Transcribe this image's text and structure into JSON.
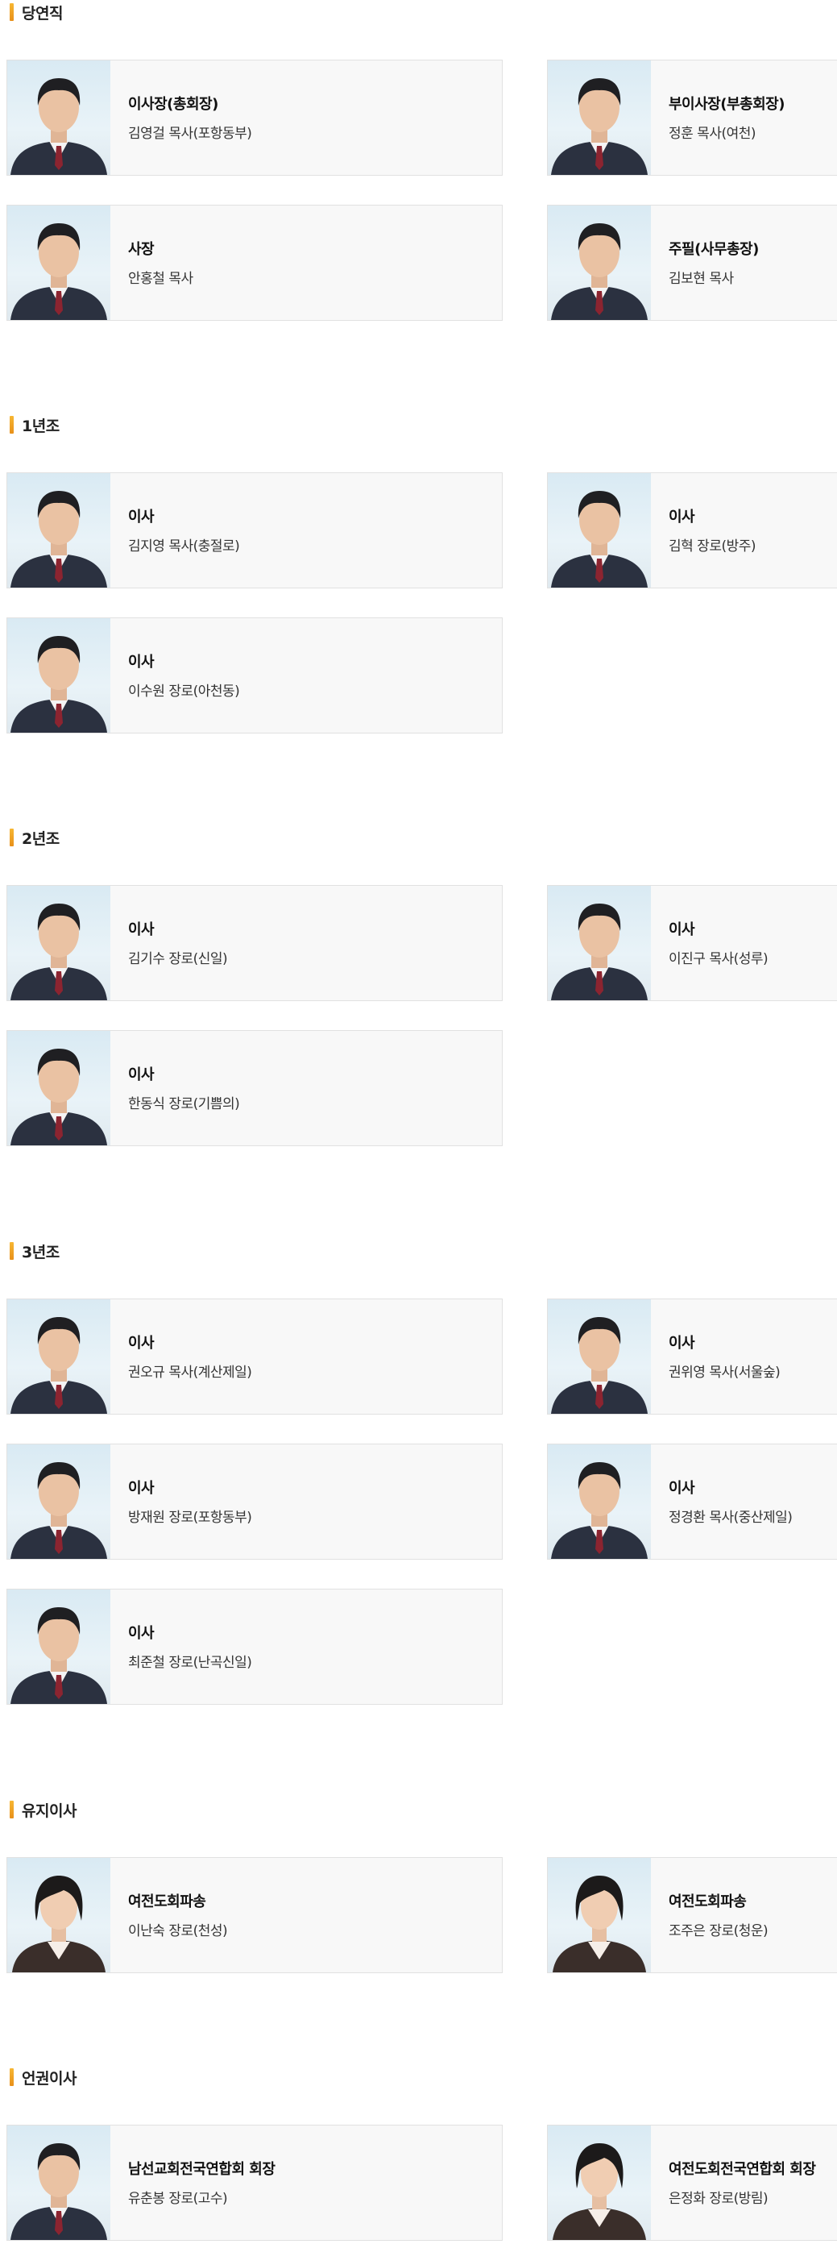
{
  "sections": [
    {
      "title": "당연직",
      "members": [
        {
          "role": "이사장(총회장)",
          "name": "김영걸 목사(포항동부)"
        },
        {
          "role": "부이사장(부총회장)",
          "name": "정훈 목사(여천)"
        },
        {
          "role": "사장",
          "name": "안홍철 목사"
        },
        {
          "role": "주필(사무총장)",
          "name": "김보현 목사"
        }
      ]
    },
    {
      "title": "1년조",
      "members": [
        {
          "role": "이사",
          "name": "김지영 목사(충절로)"
        },
        {
          "role": "이사",
          "name": "김혁 장로(방주)"
        },
        {
          "role": "이사",
          "name": "이수원 장로(아천동)"
        }
      ]
    },
    {
      "title": "2년조",
      "members": [
        {
          "role": "이사",
          "name": "김기수 장로(신일)"
        },
        {
          "role": "이사",
          "name": "이진구 목사(성루)"
        },
        {
          "role": "이사",
          "name": "한동식 장로(기쁨의)"
        }
      ]
    },
    {
      "title": "3년조",
      "members": [
        {
          "role": "이사",
          "name": "권오규 목사(계산제일)"
        },
        {
          "role": "이사",
          "name": "권위영 목사(서울숲)"
        },
        {
          "role": "이사",
          "name": "방재원 장로(포항동부)"
        },
        {
          "role": "이사",
          "name": "정경환 목사(중산제일)"
        },
        {
          "role": "이사",
          "name": "최준철 장로(난곡신일)"
        }
      ]
    },
    {
      "title": "유지이사",
      "members": [
        {
          "role": "여전도회파송",
          "name": "이난숙 장로(천성)"
        },
        {
          "role": "여전도회파송",
          "name": "조주은 장로(청운)"
        }
      ]
    },
    {
      "title": "언권이사",
      "members": [
        {
          "role": "남선교회전국연합회 회장",
          "name": "유춘봉 장로(고수)"
        },
        {
          "role": "여전도회전국연합회 회장",
          "name": "은정화 장로(방림)"
        }
      ]
    }
  ]
}
